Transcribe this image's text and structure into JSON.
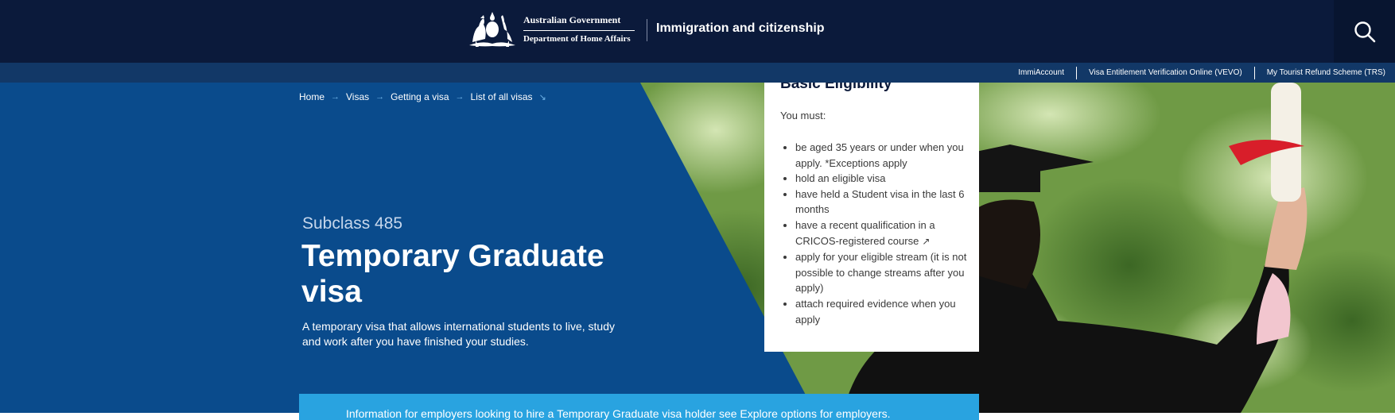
{
  "header": {
    "gov_name": "Australian Government",
    "department": "Department of Home Affairs",
    "site_name": "Immigration and citizenship",
    "search_icon": "search-icon"
  },
  "utility_links": [
    {
      "label": "ImmiAccount"
    },
    {
      "label": "Visa Entitlement Verification Online (VEVO)"
    },
    {
      "label": "My Tourist Refund Scheme (TRS)"
    }
  ],
  "breadcrumb": [
    {
      "label": "Home"
    },
    {
      "label": "Visas"
    },
    {
      "label": "Getting a visa"
    },
    {
      "label": "List of all visas"
    }
  ],
  "hero": {
    "subclass": "Subclass 485",
    "title": "Temporary Graduate visa",
    "description": "A temporary visa that allows international students to live, study and work after you have finished your studies."
  },
  "eligibility": {
    "title": "Basic Eligibility",
    "intro": "You must:",
    "items": [
      "be aged 35 years or under when you apply. *Exceptions apply",
      "hold an eligible visa",
      "have held a Student visa in the last 6 months",
      "have a recent qualification in a CRICOS-registered course",
      "apply for your eligible stream (it is not possible to change streams after you apply)",
      "attach required evidence when you apply"
    ]
  },
  "employer_banner": {
    "text": "Information for employers looking to hire a Temporary Graduate visa holder see Explore options for employers."
  },
  "colors": {
    "header_bg": "#0b1a3b",
    "utility_bg": "#123867",
    "hero_blue": "#0a4b8c",
    "banner_blue": "#29a3e0"
  }
}
